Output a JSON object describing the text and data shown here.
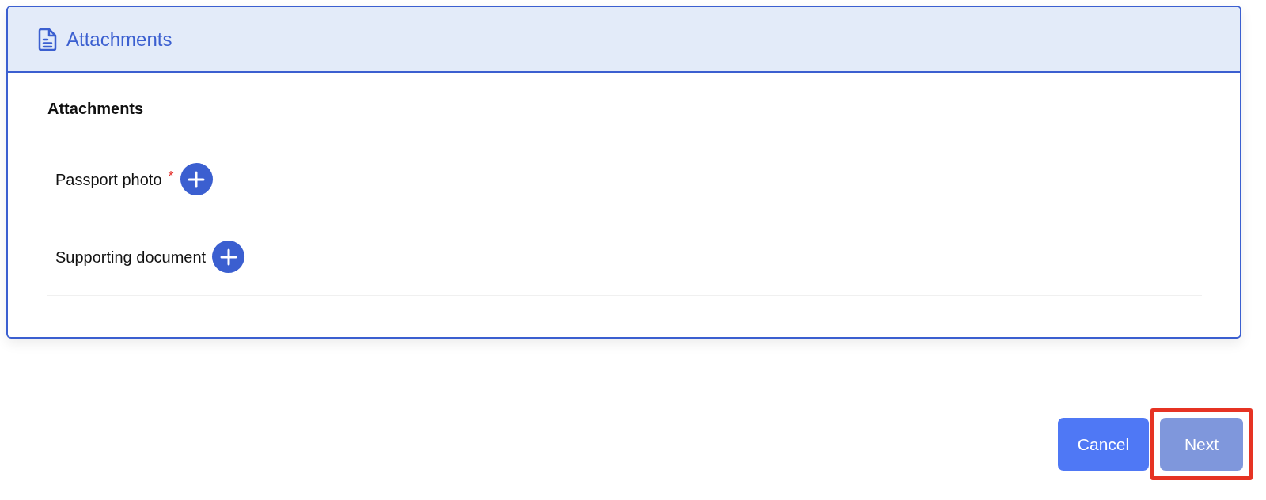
{
  "panel": {
    "title": "Attachments"
  },
  "section": {
    "heading": "Attachments"
  },
  "attachments": [
    {
      "label": "Passport photo",
      "required": true,
      "required_mark": "*"
    },
    {
      "label": "Supporting document",
      "required": false
    }
  ],
  "buttons": [
    {
      "label": "Cancel",
      "kind": "secondary",
      "disabled": false,
      "highlighted": false
    },
    {
      "label": "Next",
      "kind": "primary",
      "disabled": true,
      "highlighted": true
    }
  ]
}
